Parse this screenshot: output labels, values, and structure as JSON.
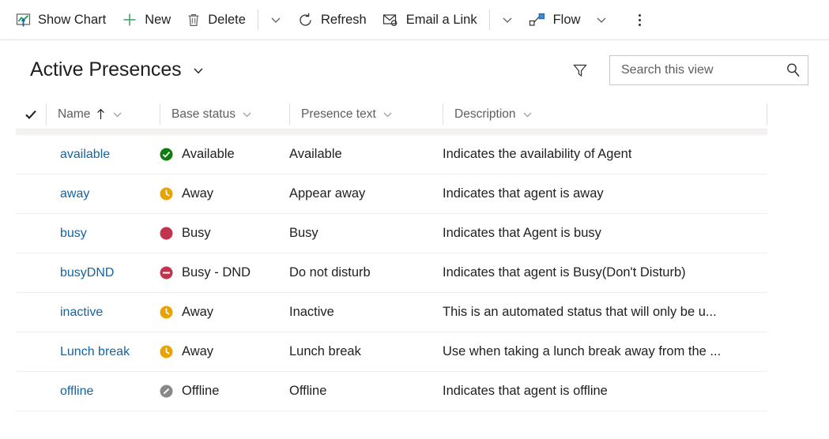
{
  "commandbar": {
    "items": [
      {
        "id": "show-chart",
        "label": "Show Chart",
        "icon": "show-chart-icon"
      },
      {
        "id": "new",
        "label": "New",
        "icon": "plus-icon"
      },
      {
        "id": "delete",
        "label": "Delete",
        "icon": "trash-icon"
      },
      {
        "id": "refresh",
        "label": "Refresh",
        "icon": "refresh-icon"
      },
      {
        "id": "email-a-link",
        "label": "Email a Link",
        "icon": "email-link-icon"
      },
      {
        "id": "flow",
        "label": "Flow",
        "icon": "flow-icon"
      }
    ],
    "overflow_label": "More commands"
  },
  "view": {
    "title": "Active Presences",
    "title_chevron": "chevron-down-icon",
    "filter_icon": "filter-icon"
  },
  "search": {
    "placeholder": "Search this view",
    "value": "",
    "icon": "search-icon"
  },
  "grid": {
    "select_all_icon": "checkmark-icon",
    "columns": [
      {
        "key": "name",
        "label": "Name",
        "sorted": "ascending",
        "sort_icon": "arrow-up-icon"
      },
      {
        "key": "base_status",
        "label": "Base status",
        "sorted": "none"
      },
      {
        "key": "presence_text",
        "label": "Presence text",
        "sorted": "none"
      },
      {
        "key": "description",
        "label": "Description",
        "sorted": "none"
      }
    ],
    "rows": [
      {
        "name": "available",
        "base_status": "Available",
        "status_icon": "status-available-icon",
        "status_color": "#107c10",
        "presence_text": "Available",
        "description": "Indicates the availability of Agent"
      },
      {
        "name": "away",
        "base_status": "Away",
        "status_icon": "status-away-icon",
        "status_color": "#e8a300",
        "presence_text": "Appear away",
        "description": "Indicates that agent is away"
      },
      {
        "name": "busy",
        "base_status": "Busy",
        "status_icon": "status-busy-icon",
        "status_color": "#c2344d",
        "presence_text": "Busy",
        "description": "Indicates that Agent is busy"
      },
      {
        "name": "busyDND",
        "base_status": "Busy - DND",
        "status_icon": "status-dnd-icon",
        "status_color": "#c2344d",
        "presence_text": "Do not disturb",
        "description": "Indicates that agent is Busy(Don't Disturb)"
      },
      {
        "name": "inactive",
        "base_status": "Away",
        "status_icon": "status-away-icon",
        "status_color": "#e8a300",
        "presence_text": "Inactive",
        "description": "This is an automated status that will only be u..."
      },
      {
        "name": "Lunch break",
        "base_status": "Away",
        "status_icon": "status-away-icon",
        "status_color": "#e8a300",
        "presence_text": "Lunch break",
        "description": "Use when taking a lunch break away from the ..."
      },
      {
        "name": "offline",
        "base_status": "Offline",
        "status_icon": "status-offline-icon",
        "status_color": "#8a8886",
        "presence_text": "Offline",
        "description": "Indicates that agent is offline"
      }
    ]
  },
  "colors": {
    "link": "#1264a3",
    "available": "#107c10",
    "away": "#e8a300",
    "busy": "#c2344d",
    "offline": "#8a8886"
  }
}
